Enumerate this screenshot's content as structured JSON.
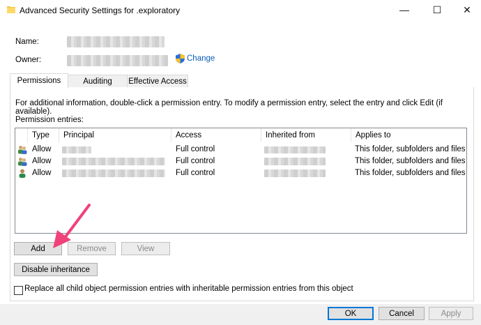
{
  "window": {
    "title": "Advanced Security Settings for .exploratory",
    "minimize_glyph": "—",
    "maximize_glyph": "☐",
    "close_glyph": "✕"
  },
  "fields": {
    "name_label": "Name:",
    "owner_label": "Owner:",
    "change_label": "Change"
  },
  "tabs": [
    {
      "label": "Permissions",
      "active": true
    },
    {
      "label": "Auditing",
      "active": false
    },
    {
      "label": "Effective Access",
      "active": false
    }
  ],
  "info_text": "For additional information, double-click a permission entry. To modify a permission entry, select the entry and click Edit (if available).",
  "permission_entries_label": "Permission entries:",
  "table": {
    "columns": [
      "Type",
      "Principal",
      "Access",
      "Inherited from",
      "Applies to"
    ],
    "rows": [
      {
        "type": "Allow",
        "access": "Full control",
        "applies_to": "This folder, subfolders and files",
        "icon": "group-users-icon"
      },
      {
        "type": "Allow",
        "access": "Full control",
        "applies_to": "This folder, subfolders and files",
        "icon": "group-users-icon"
      },
      {
        "type": "Allow",
        "access": "Full control",
        "applies_to": "This folder, subfolders and files",
        "icon": "user-icon"
      }
    ]
  },
  "buttons": {
    "add": "Add",
    "remove": "Remove",
    "view": "View",
    "disable_inheritance": "Disable inheritance",
    "ok": "OK",
    "cancel": "Cancel",
    "apply": "Apply"
  },
  "replace_checkbox": {
    "label": "Replace all child object permission entries with inheritable permission entries from this object",
    "checked": false
  },
  "colors": {
    "link": "#0b5db8",
    "arrow": "#f0427a",
    "ok_border": "#0078d7"
  }
}
